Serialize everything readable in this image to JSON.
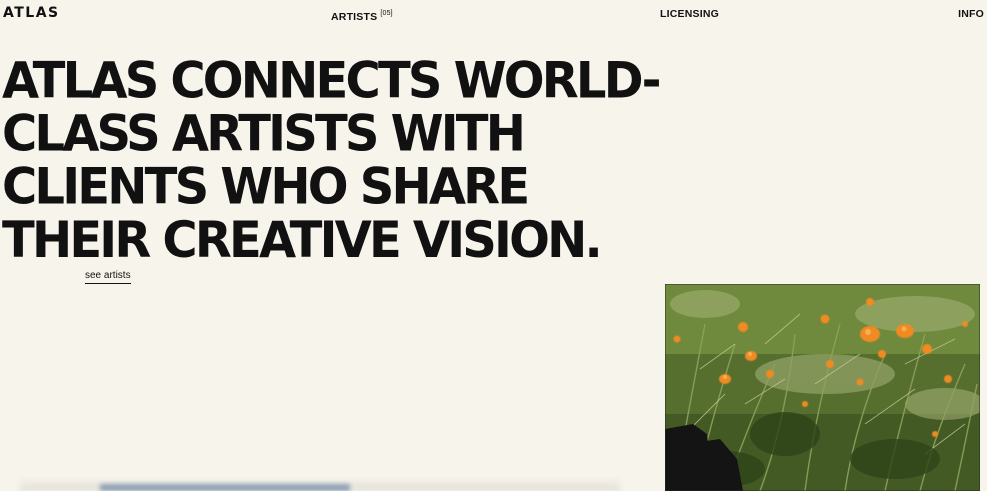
{
  "nav": {
    "logo": "ATLAS",
    "artists": {
      "label": "ARTISTS",
      "count": "[05]"
    },
    "licensing": "LICENSING",
    "info": "INFO"
  },
  "hero": {
    "headline_lines": [
      "ATLAS CONNECTS WORLD-",
      "CLASS ARTISTS WITH",
      "CLIENTS WHO SHARE",
      "THEIR CREATIVE VISION."
    ],
    "cta": "see artists"
  },
  "colors": {
    "background": "#f7f4ec",
    "text": "#111111"
  }
}
